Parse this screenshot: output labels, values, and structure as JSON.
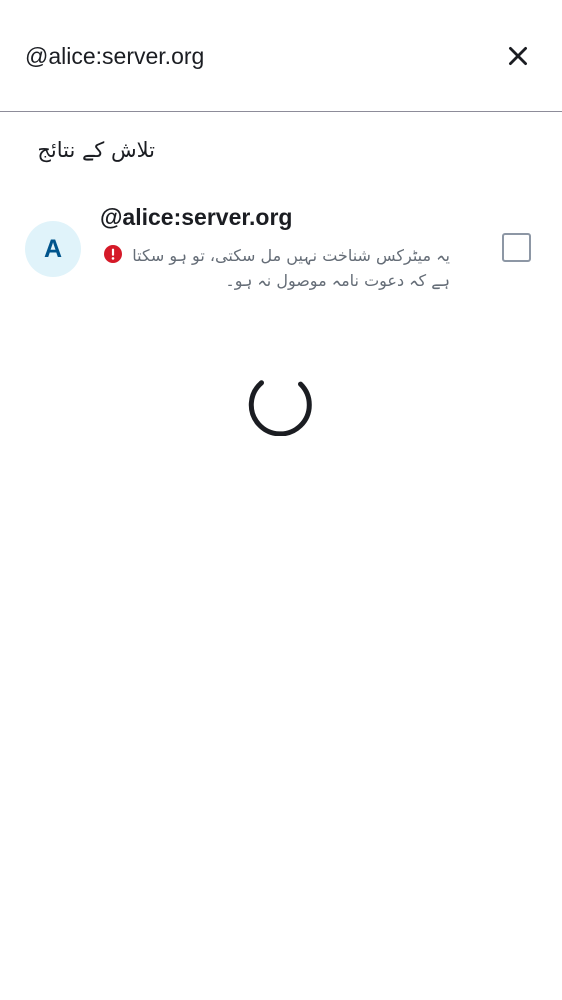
{
  "search": {
    "value": "@alice:server.org",
    "close_icon": "close-icon"
  },
  "results": {
    "section_title": "تلاش کے نتائج",
    "items": [
      {
        "avatar_letter": "A",
        "avatar_bg": "#e0f3fa",
        "avatar_fg": "#00548c",
        "name": "@alice:server.org",
        "warning_icon": "error-icon",
        "warning_color": "#d51928",
        "warning_text": "یہ میٹرکس شناخت نہیں مل سکتی، تو ہو سکتا ہے کہ دعوت نامہ موصول نہ ہو۔",
        "checked": false
      }
    ]
  },
  "loading": {
    "spinner_icon": "spinner-icon"
  }
}
